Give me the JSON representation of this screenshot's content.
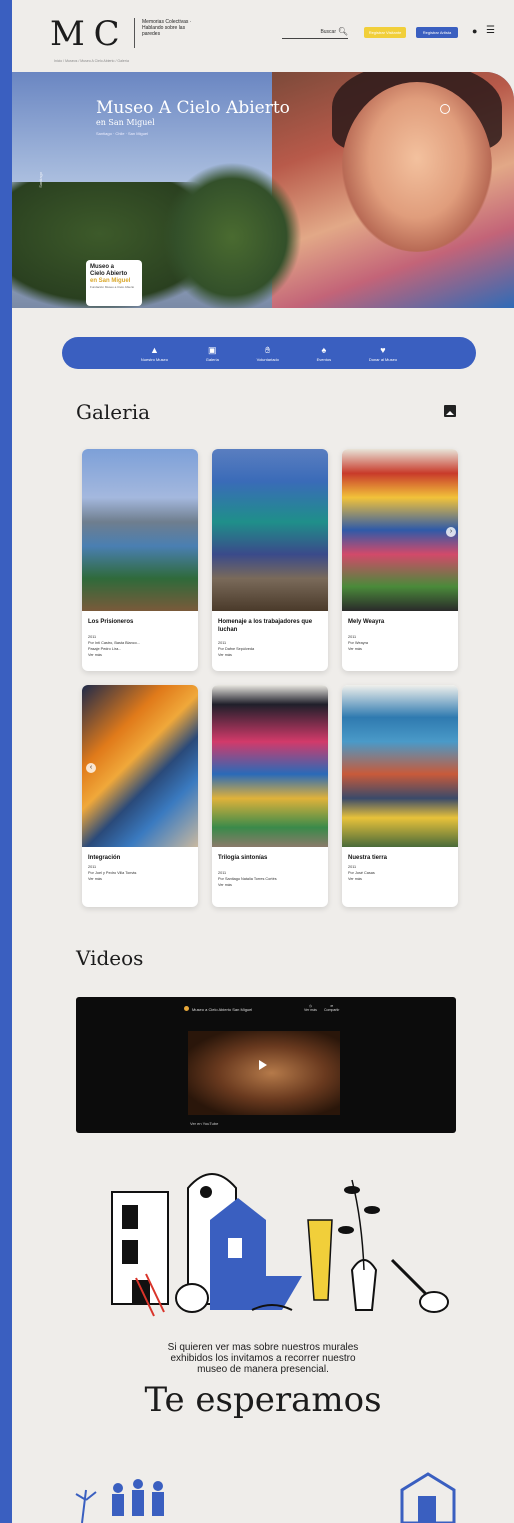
{
  "header": {
    "logo_text": "M C",
    "logo_sub": "Memorias Colectivas · Hablando sobre las paredes",
    "search_label": "Buscar",
    "register_visitor_label": "Registrar Visitante",
    "register_artist_label": "Registrar Artista",
    "breadcrumb": "Inicio / Museos / Museo A Cielo Abierto / Galería"
  },
  "hero": {
    "title": "Museo A Cielo Abierto",
    "subtitle": "en San Miguel",
    "meta": "Santiago · Chile · San Miguel",
    "side_text": "Santiago",
    "badge_line1": "Museo a",
    "badge_line2": "Cielo Abierto",
    "badge_line3": "en San Miguel",
    "badge_small": "Fundación Museo a Cielo Abierto"
  },
  "nav": {
    "items": [
      {
        "label": "Nuestro Museo",
        "icon": "museum-icon"
      },
      {
        "label": "Galería",
        "icon": "gallery-icon"
      },
      {
        "label": "Voluntariado",
        "icon": "hand-icon"
      },
      {
        "label": "Eventos",
        "icon": "event-icon"
      },
      {
        "label": "Donar al Museo",
        "icon": "heart-icon"
      }
    ]
  },
  "gallery": {
    "title": "Galeria",
    "cards": [
      {
        "title": "Los Prisioneros",
        "year": "2011",
        "author": "Por Inti Castro, Basta Blanco...",
        "place": "Pasaje Pedro Lira...",
        "more": "Ver más"
      },
      {
        "title": "Homenaje a los trabajadores que luchan",
        "year": "2011",
        "author": "Por Dafne Sepúlveda",
        "place": "Ver más",
        "more": ""
      },
      {
        "title": "Mely Weayra",
        "year": "2011",
        "author": "Por Weayra",
        "place": "Ver más",
        "more": ""
      },
      {
        "title": "Integración",
        "year": "2011",
        "author": "Por Joel y Pedro Villa Tomás",
        "place": "Ver más",
        "more": ""
      },
      {
        "title": "Trilogía sintonías",
        "year": "2011",
        "author": "Por Santiago Natalia Torres Cortés",
        "place": "Ver más",
        "more": ""
      },
      {
        "title": "Nuestra tierra",
        "year": "2011",
        "author": "Por José Casas",
        "place": "Ver más",
        "more": ""
      }
    ]
  },
  "videos": {
    "title": "Videos",
    "video_title": "Museo a Cielo Abierto San Miguel",
    "watch_later": "Ver más",
    "share": "Compartir",
    "yt": "Ver en YouTube"
  },
  "closing": {
    "text_line1": "Si quieren ver mas sobre nuestros murales",
    "text_line2": "exhibidos los invitamos a recorrer nuestro",
    "text_line3": "museo de manera presencial.",
    "headline": "Te esperamos"
  },
  "colors": {
    "brand_blue": "#3a5fc0",
    "accent_yellow": "#f1cf3a",
    "background": "#efedea"
  }
}
